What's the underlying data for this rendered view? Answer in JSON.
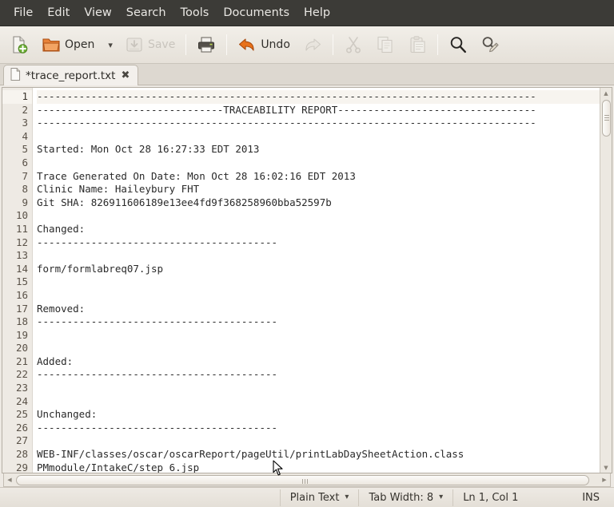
{
  "window": {
    "title": "*trace_report.txt"
  },
  "menubar": {
    "items": [
      {
        "label": "File"
      },
      {
        "label": "Edit"
      },
      {
        "label": "View"
      },
      {
        "label": "Search"
      },
      {
        "label": "Tools"
      },
      {
        "label": "Documents"
      },
      {
        "label": "Help"
      }
    ]
  },
  "toolbar": {
    "new_label": "",
    "new_icon": "new-document-icon",
    "open_label": "Open",
    "open_icon": "open-folder-icon",
    "open_caret": "▾",
    "save_label": "Save",
    "save_icon": "save-disk-icon",
    "print_icon": "print-icon",
    "undo_label": "Undo",
    "undo_icon": "undo-arrow-icon",
    "redo_icon": "redo-arrow-icon",
    "cut_icon": "cut-scissors-icon",
    "copy_icon": "copy-icon",
    "paste_icon": "paste-clipboard-icon",
    "find_icon": "find-magnifier-icon",
    "replace_icon": "find-replace-icon"
  },
  "tab": {
    "name": "*trace_report.txt",
    "close_glyph": "✖",
    "file_icon": "text-file-icon"
  },
  "editor": {
    "current_line": 1,
    "lines": [
      {
        "n": "1",
        "text": "-----------------------------------------------------------------------------------"
      },
      {
        "n": "2",
        "text": "-------------------------------TRACEABILITY REPORT---------------------------------"
      },
      {
        "n": "3",
        "text": "-----------------------------------------------------------------------------------"
      },
      {
        "n": "4",
        "text": ""
      },
      {
        "n": "5",
        "text": "Started: Mon Oct 28 16:27:33 EDT 2013"
      },
      {
        "n": "6",
        "text": ""
      },
      {
        "n": "7",
        "text": "Trace Generated On Date: Mon Oct 28 16:02:16 EDT 2013"
      },
      {
        "n": "8",
        "text": "Clinic Name: Haileybury FHT"
      },
      {
        "n": "9",
        "text": "Git SHA: 826911606189e13ee4fd9f368258960bba52597b"
      },
      {
        "n": "10",
        "text": ""
      },
      {
        "n": "11",
        "text": "Changed:"
      },
      {
        "n": "12",
        "text": "----------------------------------------"
      },
      {
        "n": "13",
        "text": ""
      },
      {
        "n": "14",
        "text": "form/formlabreq07.jsp"
      },
      {
        "n": "15",
        "text": ""
      },
      {
        "n": "16",
        "text": ""
      },
      {
        "n": "17",
        "text": "Removed:"
      },
      {
        "n": "18",
        "text": "----------------------------------------"
      },
      {
        "n": "19",
        "text": ""
      },
      {
        "n": "20",
        "text": ""
      },
      {
        "n": "21",
        "text": "Added:"
      },
      {
        "n": "22",
        "text": "----------------------------------------"
      },
      {
        "n": "23",
        "text": ""
      },
      {
        "n": "24",
        "text": ""
      },
      {
        "n": "25",
        "text": "Unchanged:"
      },
      {
        "n": "26",
        "text": "----------------------------------------"
      },
      {
        "n": "27",
        "text": ""
      },
      {
        "n": "28",
        "text": "WEB-INF/classes/oscar/oscarReport/pageUtil/printLabDaySheetAction.class"
      },
      {
        "n": "29",
        "text": "PMmodule/IntakeC/step_6.jsp"
      }
    ]
  },
  "statusbar": {
    "language": "Plain Text",
    "language_caret": "▾",
    "tab_width": "Tab Width: 8",
    "tab_width_caret": "▾",
    "position": "Ln 1, Col 1",
    "insert_mode": "INS"
  },
  "colors": {
    "menubar_bg": "#3c3b37",
    "toolbar_bg": "#ede9e3",
    "editor_bg": "#ffffff",
    "gutter_bg": "#eeeae4",
    "accent_orange": "#e8711a"
  }
}
